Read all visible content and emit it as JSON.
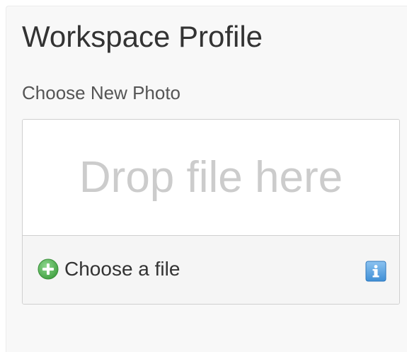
{
  "header": {
    "title": "Workspace Profile"
  },
  "photo_section": {
    "label": "Choose New Photo",
    "drop_zone_text": "Drop file here",
    "choose_file_label": "Choose a file",
    "icons": {
      "choose": "plus-circle-icon",
      "info": "info-icon"
    },
    "colors": {
      "plus_green": "#5cb85c",
      "info_blue": "#3f8fd6",
      "drop_text": "#cccccc"
    }
  }
}
